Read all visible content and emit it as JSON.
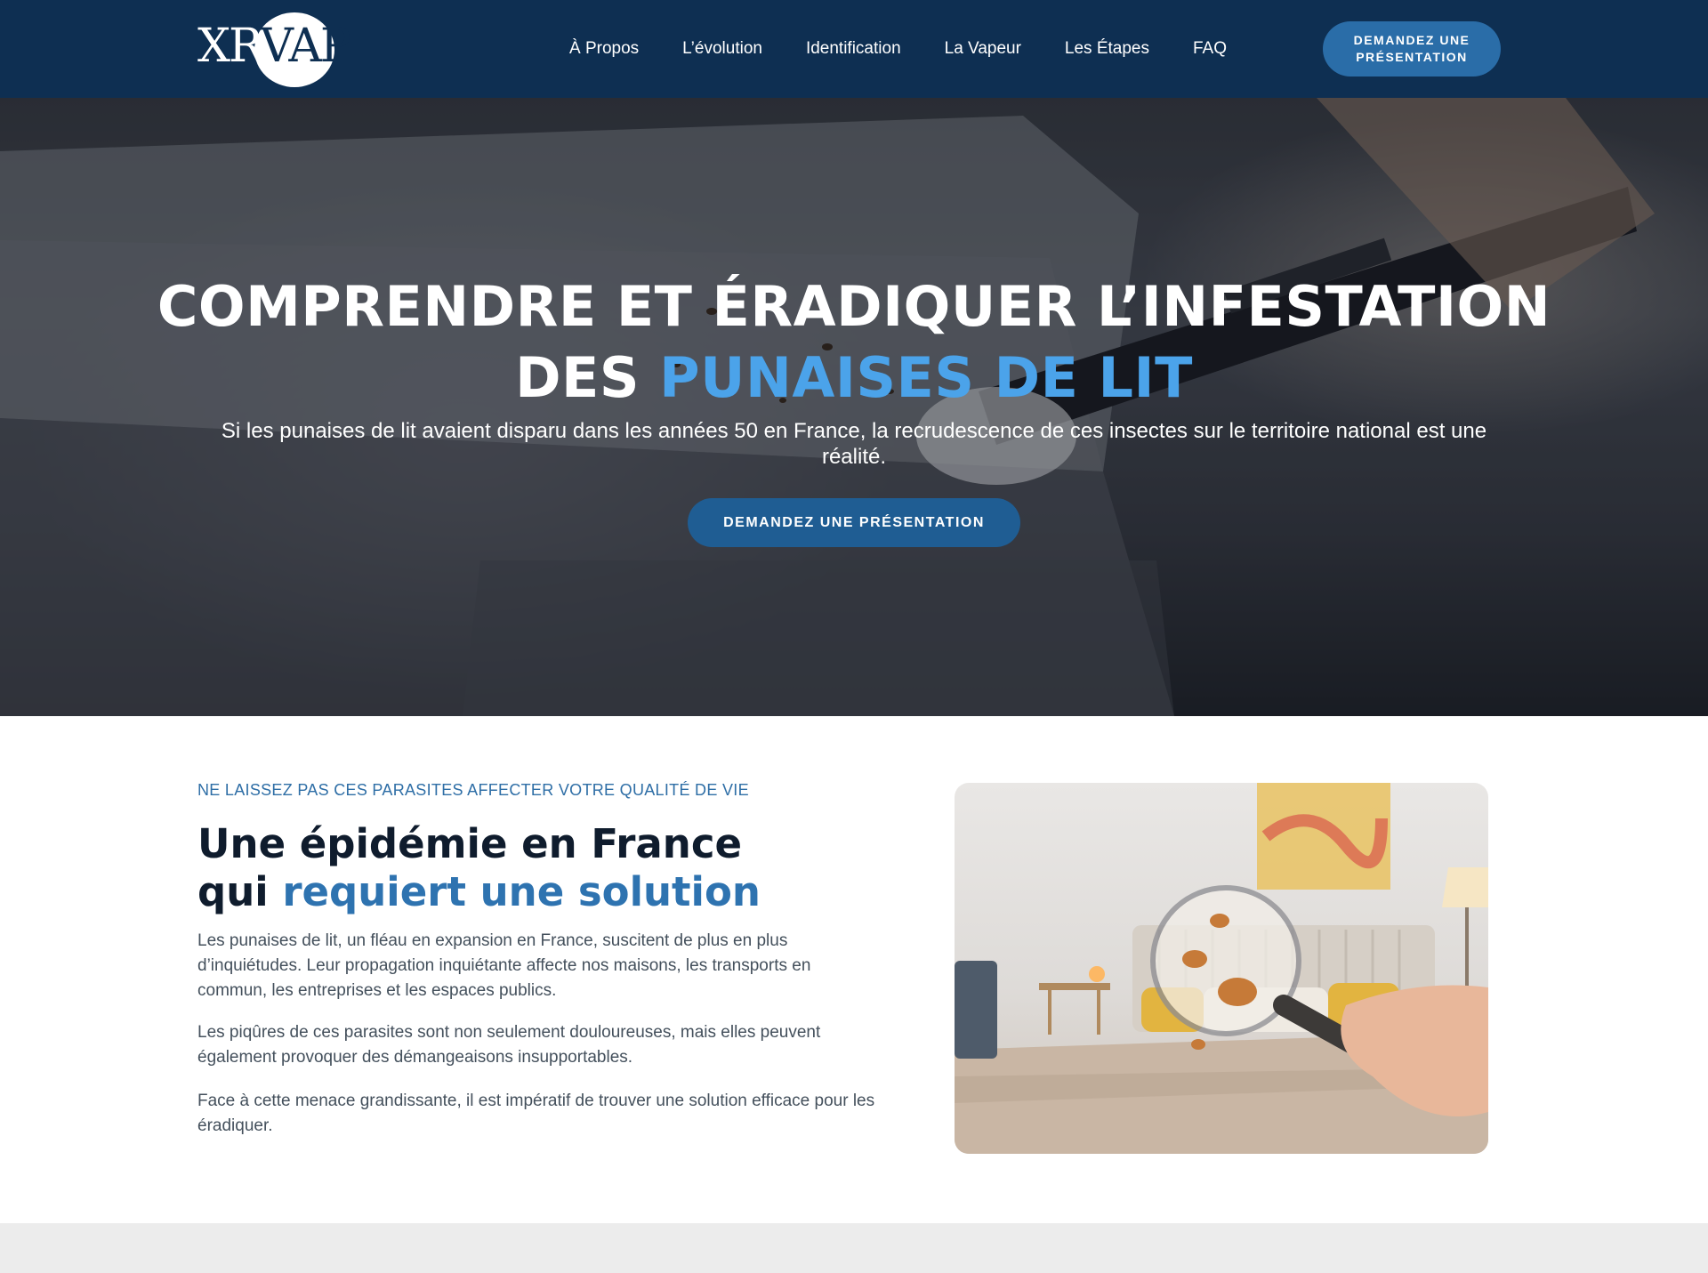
{
  "brand": {
    "logo_left": "XR",
    "logo_right": "VAP"
  },
  "nav": {
    "items": [
      {
        "label": "À Propos"
      },
      {
        "label": "L’évolution"
      },
      {
        "label": "Identification"
      },
      {
        "label": "La Vapeur"
      },
      {
        "label": "Les Étapes"
      },
      {
        "label": "FAQ"
      }
    ],
    "cta_label": "DEMANDEZ UNE PRÉSENTATION"
  },
  "hero": {
    "title_line1": "COMPRENDRE ET ÉRADIQUER L’INFESTATION",
    "title_line2_prefix": "DES ",
    "title_line2_accent": "PUNAISES DE LIT",
    "subtitle": "Si les punaises de lit avaient disparu dans les années 50 en France, la recrudescence de ces insectes sur le territoire national est une réalité.",
    "cta_label": "DEMANDEZ UNE PRÉSENTATION"
  },
  "section": {
    "kicker": "NE LAISSEZ PAS CES PARASITES AFFECTER VOTRE QUALITÉ DE VIE",
    "title_line1": "Une épidémie en France",
    "title_line2_prefix": "qui ",
    "title_line2_accent": "requiert une solution",
    "paragraphs": [
      "Les punaises de lit, un fléau en expansion en France, suscitent de plus en plus d’inquiétudes. Leur propagation inquiétante affecte nos maisons, les transports en commun, les entreprises et les espaces publics.",
      "Les piqûres de ces parasites sont non seulement douloureuses, mais elles peuvent également provoquer des démangeaisons insupportables.",
      "Face à cette menace grandissante, il est impératif de trouver une solution efficace pour les éradiquer."
    ]
  },
  "colors": {
    "nav_bg": "#0e2f52",
    "cta_bg": "#2a6da8",
    "accent_blue": "#4ba3ea",
    "section_accent": "#2e73b0"
  },
  "icons": {
    "hero_image": "bed-steam-cleaning-photo",
    "section_image": "bedroom-magnifier-bedbugs-photo"
  }
}
